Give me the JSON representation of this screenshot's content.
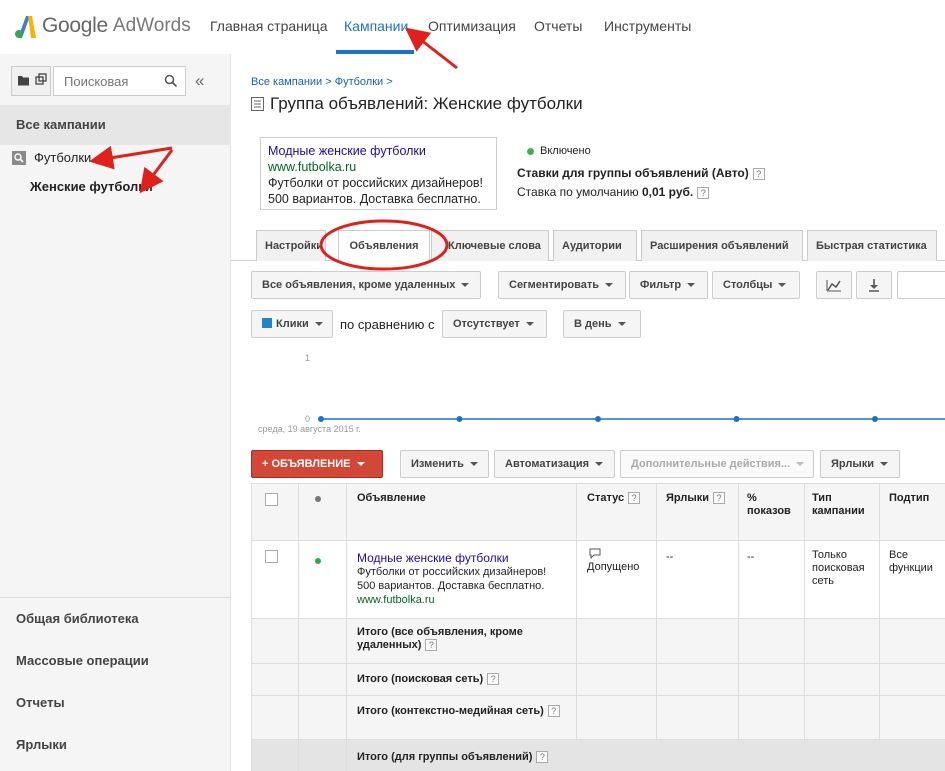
{
  "header": {
    "logo_google": "Google",
    "logo_product": "AdWords",
    "nav": [
      "Главная страница",
      "Кампании",
      "Оптимизация",
      "Отчеты",
      "Инструменты"
    ],
    "active_nav": "Кампании",
    "accent": "#1a73c9"
  },
  "sidebar": {
    "search_placeholder": "Поисковая",
    "collapse_label": "«",
    "all_campaigns": "Все кампании",
    "campaign": "Футболки",
    "ad_group": "Женские футболки",
    "bottom_links": [
      "Общая библиотека",
      "Массовые операции",
      "Отчеты",
      "Ярлыки"
    ]
  },
  "main": {
    "breadcrumb": "Все кампании > Футболки >",
    "title": "Группа объявлений: Женские футболки",
    "ad_preview": {
      "headline": "Модные женские футболки",
      "url": "www.futbolka.ru",
      "line1": "Футболки от российских дизайнеров!",
      "line2": "500 вариантов. Доставка бесплатно."
    },
    "status": "Включено",
    "bids_label": "Ставки для группы объявлений (Авто)",
    "default_bid_label": "Ставка по умолчанию",
    "default_bid_value": "0,01 руб.",
    "help_glyph": "?",
    "tabs": [
      "Настройки",
      "Объявления",
      "Ключевые слова",
      "Аудитории",
      "Расширения объявлений",
      "Быстрая статистика"
    ],
    "active_tab": "Объявления",
    "toolbar": {
      "filter_all": "Все объявления, кроме удаленных",
      "segment": "Сегментировать",
      "filter": "Фильтр",
      "columns": "Столбцы"
    },
    "chart_controls": {
      "metric": "Клики",
      "compare_label": "по сравнению с",
      "compare_value": "Отсутствует",
      "period": "В день"
    },
    "chart_date": "среда, 19 августа 2015 г.",
    "actions": {
      "new_ad": "+ ОБЪЯВЛЕНИЕ",
      "change": "Изменить",
      "automate": "Автоматизация",
      "more": "Дополнительные действия...",
      "labels": "Ярлыки"
    },
    "table": {
      "headers": [
        "Объявление",
        "Статус",
        "Ярлыки",
        "% показов",
        "Тип кампании",
        "Подтип"
      ],
      "row": {
        "headline": "Модные женские футболки",
        "line1": "Футболки от российских дизайнеров!",
        "line2": "500 вариантов. Доставка бесплатно.",
        "url": "www.futbolka.ru",
        "status": "Допущено",
        "labels": "--",
        "impr": "--",
        "campaign_type": "Только поисковая сеть",
        "subtype": "Все функции"
      },
      "totals": [
        "Итого (все объявления, кроме удаленных)",
        "Итого (поисковая сеть)",
        "Итого (контекстно-медийная сеть)",
        "Итого (для группы объявлений)"
      ]
    }
  },
  "chart_data": {
    "type": "line",
    "x": [
      "1",
      "2",
      "3",
      "4",
      "5",
      "6"
    ],
    "series": [
      {
        "values": [
          0,
          0,
          0,
          0,
          0,
          0
        ]
      }
    ],
    "ylim": [
      0,
      1
    ],
    "y_ticks": [
      "1",
      "0"
    ],
    "color": "#1a73c9"
  }
}
